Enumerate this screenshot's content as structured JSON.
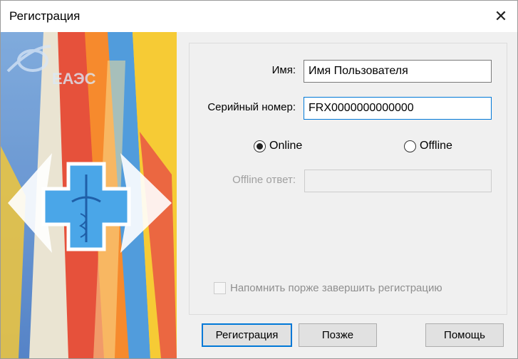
{
  "window": {
    "title": "Регистрация",
    "close_glyph": "✕"
  },
  "banner": {
    "logo_text": "ЕАЭС"
  },
  "form": {
    "name_label": "Имя:",
    "name_value": "Имя Пользователя",
    "serial_label": "Серийный номер:",
    "serial_value": "FRX0000000000000",
    "radio_online": "Online",
    "radio_offline": "Offline",
    "selected_mode": "Online",
    "offline_label": "Offline ответ:",
    "offline_value": "",
    "remind_label": "Напомнить порже завершить регистрацию",
    "remind_checked": false
  },
  "buttons": {
    "register": "Регистрация",
    "later": "Позже",
    "help": "Помощь"
  },
  "colors": {
    "accent": "#0078d7"
  }
}
